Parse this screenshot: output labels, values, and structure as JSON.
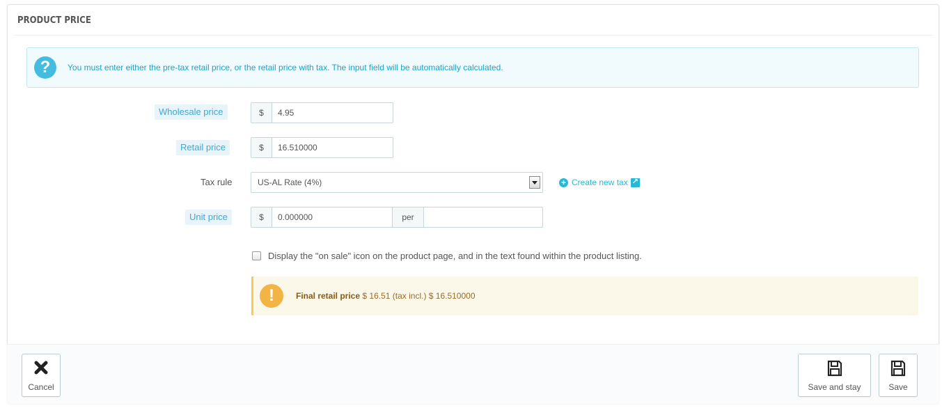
{
  "panel": {
    "title": "PRODUCT PRICE"
  },
  "info_alert": {
    "icon": "question-icon",
    "text": "You must enter either the pre-tax retail price, or the retail price with tax. The input field will be automatically calculated."
  },
  "fields": {
    "wholesale": {
      "label": "Wholesale price",
      "currency": "$",
      "value": "4.95"
    },
    "retail": {
      "label": "Retail price",
      "currency": "$",
      "value": "16.510000"
    },
    "tax_rule": {
      "label": "Tax rule",
      "selected": "US-AL Rate (4%)",
      "create_link": "Create new tax"
    },
    "unit_price": {
      "label": "Unit price",
      "currency": "$",
      "value": "0.000000",
      "per_label": "per",
      "per_value": ""
    }
  },
  "on_sale": {
    "checked": false,
    "label": "Display the \"on sale\" icon on the product page, and in the text found within the product listing."
  },
  "final_price": {
    "icon": "exclamation-icon",
    "label": "Final retail price",
    "text": "$ 16.51 (tax incl.) $ 16.510000"
  },
  "footer": {
    "cancel_label": "Cancel",
    "save_stay_label": "Save and stay",
    "save_label": "Save"
  },
  "colors": {
    "accent": "#25b9d7",
    "info_bg": "#f1fbfd",
    "warning_bg": "#fcf8e9",
    "warning_icon": "#f3b446"
  }
}
